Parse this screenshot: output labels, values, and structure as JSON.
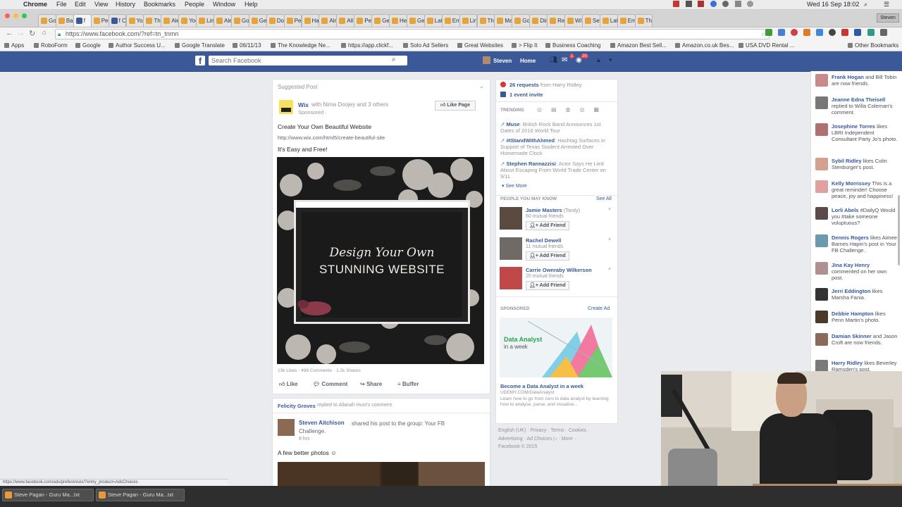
{
  "mac_menu": {
    "app": "Chrome",
    "items": [
      "File",
      "Edit",
      "View",
      "History",
      "Bookmarks",
      "People",
      "Window",
      "Help"
    ],
    "datetime": "Wed 16 Sep  18:02"
  },
  "tabs": [
    "Goo",
    "Bac",
    "f",
    "Peo",
    "f Cli",
    "You",
    "The",
    "Ale",
    "You",
    "Lin",
    "Ale",
    "Goo",
    "Get",
    "Dov",
    "Per",
    "Hai",
    "Alm",
    "All",
    "Per",
    "Get",
    "Hel",
    "Get",
    "Lat",
    "Em",
    "Lin",
    "The",
    "Ma",
    "Go",
    "Dir",
    "Ret",
    "Wit",
    "Set",
    "Lat",
    "Em",
    "The"
  ],
  "addr": {
    "url": "https://www.facebook.com/?ref=tn_tnmn"
  },
  "bookmarks": [
    "Apps",
    "RoboForm",
    "Google",
    "Author Success U...",
    "Google Translate",
    "06/11/13",
    "The Knowledge Ne...",
    "https://app.clickf...",
    "Solo Ad Sellers",
    "Great Websites",
    "> Flip It",
    "Business Coaching",
    "Amazon Best Sell...",
    "Amazon.co.uk Bes...",
    "USA DVD Rental ...",
    "Other Bookmarks"
  ],
  "fb": {
    "search_placeholder": "Search Facebook",
    "user": "Steven",
    "home": "Home",
    "badge1": "1",
    "badge2": "20"
  },
  "post": {
    "label": "Suggested Post",
    "page": "Wix",
    "with_text": "with Nima Doojey and 3 others",
    "sponsored": "Sponsored · ",
    "like_page": "Like Page",
    "headline": "Create Your Own Beautiful Website",
    "url": "http://www.wix.com/html5/create-beautiful-site",
    "tagline": "It's Easy and Free!",
    "image_line1": "Design Your Own",
    "image_line2": "STUNNING WEBSITE",
    "stats": "13k Likes · 496 Comments · 1.2k Shares",
    "actions": [
      "Like",
      "Comment",
      "Share",
      "Buffer"
    ]
  },
  "post2": {
    "context_name": "Felicity Groves",
    "context_text": "replied to Allanah Hunt's comment.",
    "author": "Steven Aitchison",
    "author_text": "shared his post to the group: Your FB Challenge.",
    "time": "8 hrs · ",
    "text": "A few better photos ☺"
  },
  "sidebar": {
    "requests": "26 requests",
    "requests_from": "from Harry Ridley",
    "event": "1 event invite",
    "trending_label": "TRENDING",
    "trends": [
      {
        "name": "Muse",
        "text": ": British Rock Band Announces 1st Dates of 2016 World Tour"
      },
      {
        "name": "#IStandWithAhmed",
        "text": ": Hashtag Surfaces in Support of Texas Student Arrested Over Homemade Clock"
      },
      {
        "name": "Stephen Rannazzisi",
        "text": ": Actor Says He Lied About Escaping From World Trade Center on 9/11"
      }
    ],
    "see_more": "See More",
    "pymk_label": "PEOPLE YOU MAY KNOW",
    "see_all": "See All",
    "people": [
      {
        "name": "Jamie Masters",
        "extra": " (Tardy)",
        "mutual": "60 mutual friends",
        "btn": "Add Friend"
      },
      {
        "name": "Rachel Dewell",
        "extra": "",
        "mutual": "11 mutual friends",
        "btn": "Add Friend"
      },
      {
        "name": "Carrie Ownraby Wilkerson",
        "extra": "",
        "mutual": "20 mutual friends",
        "btn": "Add Friend"
      }
    ],
    "sponsored_label": "SPONSORED",
    "create_ad": "Create Ad",
    "ad_image_text1": "Data Analyst",
    "ad_image_text2": "in a week",
    "ad_title": "Become a Data Analyst in a week",
    "ad_domain": "UDEMY.COM/DataAnalyst",
    "ad_text": "Learn how to go from zero to data analyst by learning how to analyse, parse, and visualise...",
    "footer1": "English (UK) · Privacy · Terms · Cookies ·",
    "footer2": "Advertising · Ad Choices ▷ · More ·",
    "footer3": "Facebook © 2015"
  },
  "ticker": [
    {
      "name": "Frank Hogan",
      "text": "and Bill Tobin are now friends."
    },
    {
      "name": "Jeanne Edna Theisell",
      "text": "replied to Willa Coleman's comment."
    },
    {
      "name": "Josephine Torres",
      "text": "likes LBRI Independent Consultant Party Jo's photo."
    },
    {
      "name": "Sybil Ridley",
      "text": "likes Colin Stenburger's post."
    },
    {
      "name": "Kelly Morrissey",
      "text": "This is a great reminder! Choose peace, joy and happiness!"
    },
    {
      "name": "Lorli Abels",
      "text": "#DailyQ Would you #take someone voluptuous?"
    },
    {
      "name": "Dennis Rogers",
      "text": "likes Aimee Barnes Hapin's post in Your FB Challenge."
    },
    {
      "name": "Jina Kay Henry",
      "text": "commented on her own post."
    },
    {
      "name": "Jerri Eddington",
      "text": "likes Marsha Fania."
    },
    {
      "name": "Debbie Hampton",
      "text": "likes Penn Martin's photo."
    },
    {
      "name": "Damian Skinner",
      "text": "and Jason Croft are now friends."
    },
    {
      "name": "Harry Ridley",
      "text": "likes Beverley Ramsden's post."
    }
  ],
  "statusbar": "https://www.facebook.com/ads/preferences/?entry_product=AdsChoices",
  "taskbar": [
    "Steve Pagan - Guru Ma...txt",
    "Steve Pagan - Guru Ma...txt"
  ],
  "colors": {
    "fb_blue": "#3b5998",
    "link": "#365899",
    "bg": "#e9ebee"
  }
}
